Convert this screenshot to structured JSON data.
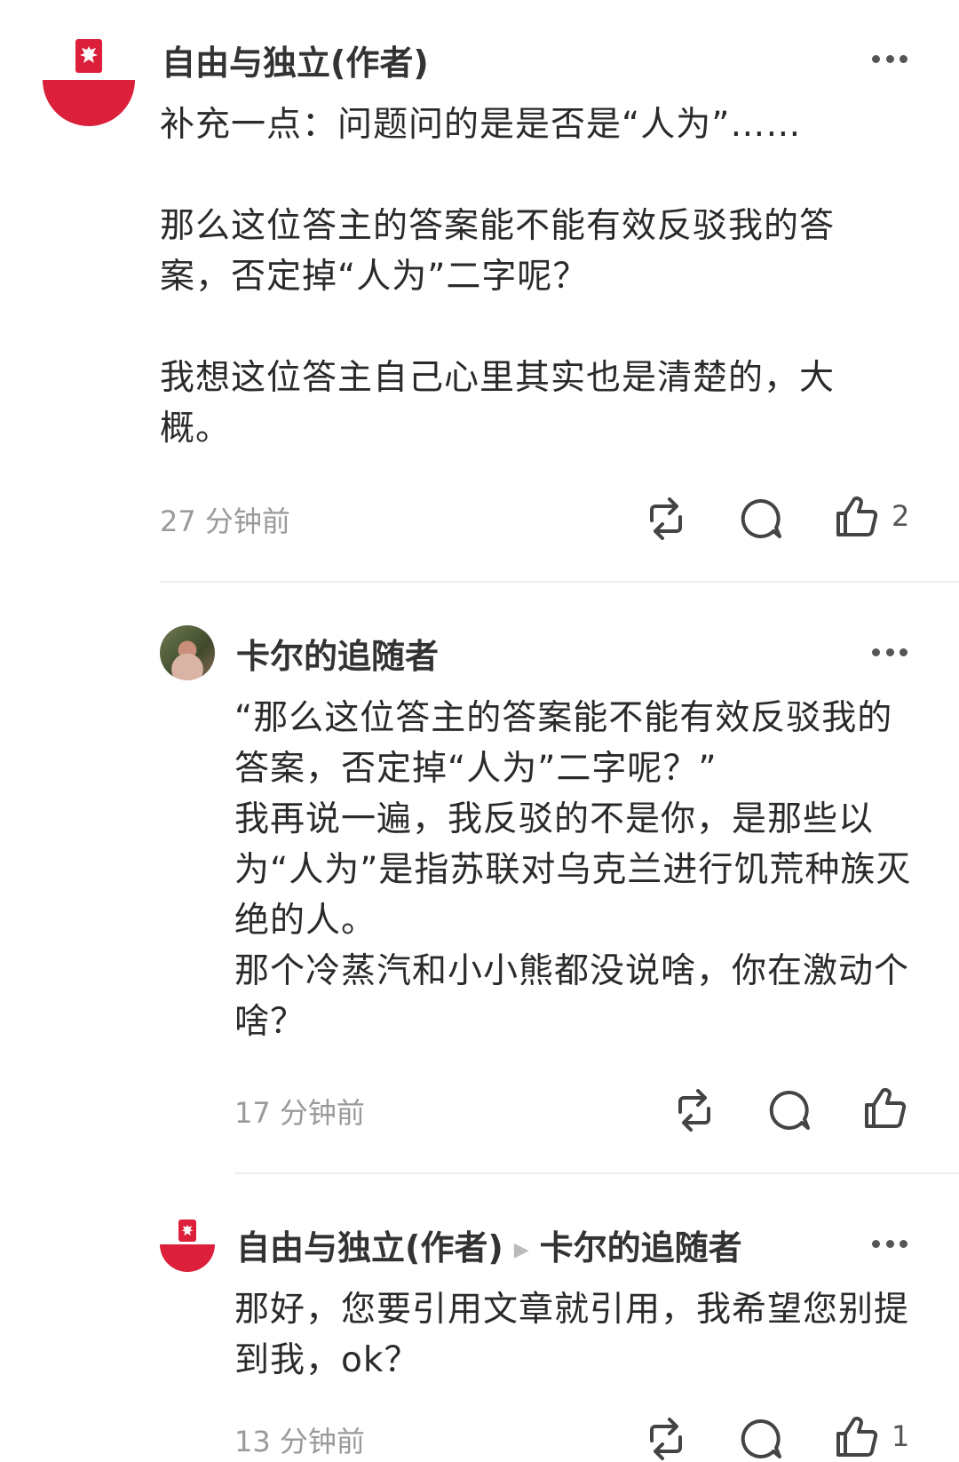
{
  "comments": [
    {
      "author": "自由与独立(作者)",
      "reply_to": "",
      "paragraphs": [
        "补充一点：问题问的是是否是“人为”……",
        "",
        "那么这位答主的答案能不能有效反驳我的答案，否定掉“人为”二字呢？",
        "",
        "我想这位答主自己心里其实也是清楚的，大概。"
      ],
      "time": "27 分钟前",
      "likes": "2",
      "avatar": "poland-flag"
    },
    {
      "author": "卡尔的追随者",
      "reply_to": "",
      "paragraphs": [
        "“那么这位答主的答案能不能有效反驳我的答案，否定掉“人为”二字呢？”",
        "我再说一遍，我反驳的不是你，是那些以为“人为”是指苏联对乌克兰进行饥荒种族灭绝的人。",
        "那个冷蒸汽和小小熊都没说啥，你在激动个啥？"
      ],
      "time": "17 分钟前",
      "likes": "",
      "avatar": "photo"
    },
    {
      "author": "自由与独立(作者)",
      "reply_to": "卡尔的追随者",
      "paragraphs": [
        "那好，您要引用文章就引用，我希望您别提到我，ok？"
      ],
      "time": "13 分钟前",
      "likes": "1",
      "avatar": "poland-flag"
    }
  ],
  "colors": {
    "flag_red": "#dc1f3a",
    "text": "#2a2a2a",
    "meta": "#9a9a9a"
  }
}
